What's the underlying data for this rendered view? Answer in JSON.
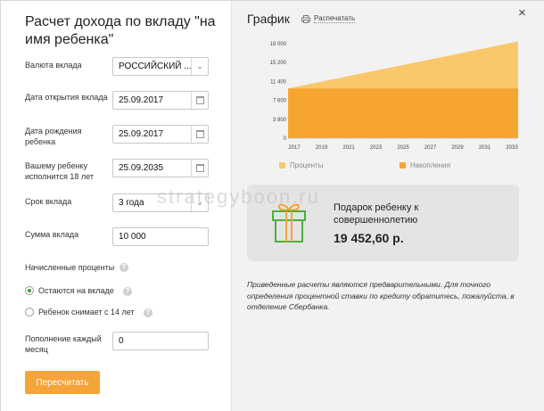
{
  "title": "Расчет дохода по вкладу \"на имя ребенка\"",
  "form": {
    "currency": {
      "label": "Валюта вклада",
      "value": "РОССИЙСКИЙ ..."
    },
    "open_date": {
      "label": "Дата открытия вклада",
      "value": "25.09.2017"
    },
    "birth_date": {
      "label": "Дата рождения ребенка",
      "value": "25.09.2017"
    },
    "age18": {
      "label": "Вашему ребенку исполнится 18 лет",
      "value": "25.09.2035"
    },
    "term": {
      "label": "Срок вклада",
      "value": "3 года"
    },
    "amount": {
      "label": "Сумма вклада",
      "value": "10 000"
    },
    "interest_label": "Начисленные проценты",
    "radio_stay": "Остаются на вкладе",
    "radio_withdraw": "Ребенок снимает с 14 лет",
    "monthly": {
      "label": "Пополнение каждый месяц",
      "value": "0"
    },
    "recalc_button": "Пересчитать"
  },
  "graph": {
    "title": "График",
    "print_label": "Распечатать",
    "close": "×"
  },
  "chart_data": {
    "type": "area",
    "x": [
      2017,
      2019,
      2021,
      2023,
      2025,
      2027,
      2029,
      2031,
      2033
    ],
    "yticks": [
      "19 000",
      "15 200",
      "11 400",
      "7 600",
      "3 800",
      "0"
    ],
    "ylim": [
      0,
      19000
    ],
    "series": [
      {
        "name": "Проценты",
        "color": "#f9c86a",
        "start": 10000,
        "end": 19452.6
      },
      {
        "name": "Накопления",
        "color": "#f7a531",
        "start": 10000,
        "end": 10000
      }
    ]
  },
  "gift": {
    "text": "Подарок ребенку к совершеннолетию",
    "amount": "19 452,60 р."
  },
  "note": "Приведенные расчеты являются предварительными. Для точного определения процентной ставки по кредиту обратитесь, пожалуйста, в отделение Сбербанка.",
  "watermark": "strategyboon.ru"
}
